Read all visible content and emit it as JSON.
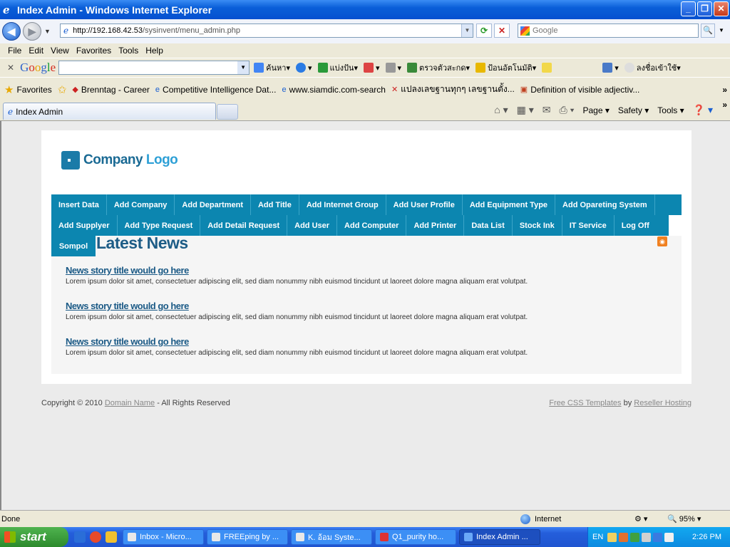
{
  "window": {
    "title": "Index Admin - Windows Internet Explorer"
  },
  "address": {
    "url_host": "http://192.168.42.53",
    "url_path": "/sysinvent/menu_admin.php"
  },
  "search": {
    "placeholder": "Google"
  },
  "menu": [
    "File",
    "Edit",
    "View",
    "Favorites",
    "Tools",
    "Help"
  ],
  "google_toolbar": {
    "logo": "Google",
    "items": [
      "ค้นหา",
      "แบ่งปัน",
      "ตรวจตัวสะกด",
      "ป้อนอัตโนมัติ",
      "ลงชื่อเข้าใช้"
    ]
  },
  "favorites": {
    "label": "Favorites",
    "items": [
      "Brenntag - Career",
      "Competitive Intelligence Dat...",
      "www.siamdic.com-search",
      "แปลงเลขฐานทุกๆ เลขฐานตั้ง...",
      "Definition of visible adjectiv..."
    ]
  },
  "tab": {
    "title": "Index Admin"
  },
  "commands": [
    "Page",
    "Safety",
    "Tools"
  ],
  "site": {
    "logo_company": "Company",
    "logo_word": "Logo",
    "nav_row1": [
      "Insert Data",
      "Add Company",
      "Add Department",
      "Add Title",
      "Add Internet Group",
      "Add User Profile",
      "Add Equipment Type",
      "Add Opareting System"
    ],
    "nav_row2": [
      "Add Supplyer",
      "Add Type Request",
      "Add Detail Request",
      "Add User",
      "Add Computer",
      "Add Printer",
      "Data List",
      "Stock Ink",
      "IT Service",
      "Log Off"
    ],
    "user": "Sompol",
    "heading": "Latest News",
    "stories": [
      {
        "title": "News story title would go here",
        "text": "Lorem ipsum dolor sit amet, consectetuer adipiscing elit, sed diam nonummy nibh euismod tincidunt ut laoreet dolore magna aliquam erat volutpat."
      },
      {
        "title": "News story title would go here",
        "text": "Lorem ipsum dolor sit amet, consectetuer adipiscing elit, sed diam nonummy nibh euismod tincidunt ut laoreet dolore magna aliquam erat volutpat."
      },
      {
        "title": "News story title would go here",
        "text": "Lorem ipsum dolor sit amet, consectetuer adipiscing elit, sed diam nonummy nibh euismod tincidunt ut laoreet dolore magna aliquam erat volutpat."
      }
    ],
    "footer": {
      "copyright_prefix": "Copyright © 2010",
      "domain_link": "Domain Name",
      "rights": "- All Rights Reserved",
      "templates_link": "Free CSS Templates",
      "by": "by",
      "hosting_link": "Reseller Hosting"
    }
  },
  "status": {
    "text": "Done",
    "zone": "Internet",
    "zoom": "95%"
  },
  "taskbar": {
    "start": "start",
    "tasks": [
      "Inbox - Micro...",
      "FREEping by ...",
      "K. อ้อม Syste...",
      "Q1_purity ho...",
      "Index Admin ..."
    ],
    "lang": "EN",
    "clock": "2:26 PM"
  },
  "colors": {
    "nav_bg": "#0c86b0",
    "heading": "#1d5c86",
    "titlebar": "#0a5fd8"
  }
}
